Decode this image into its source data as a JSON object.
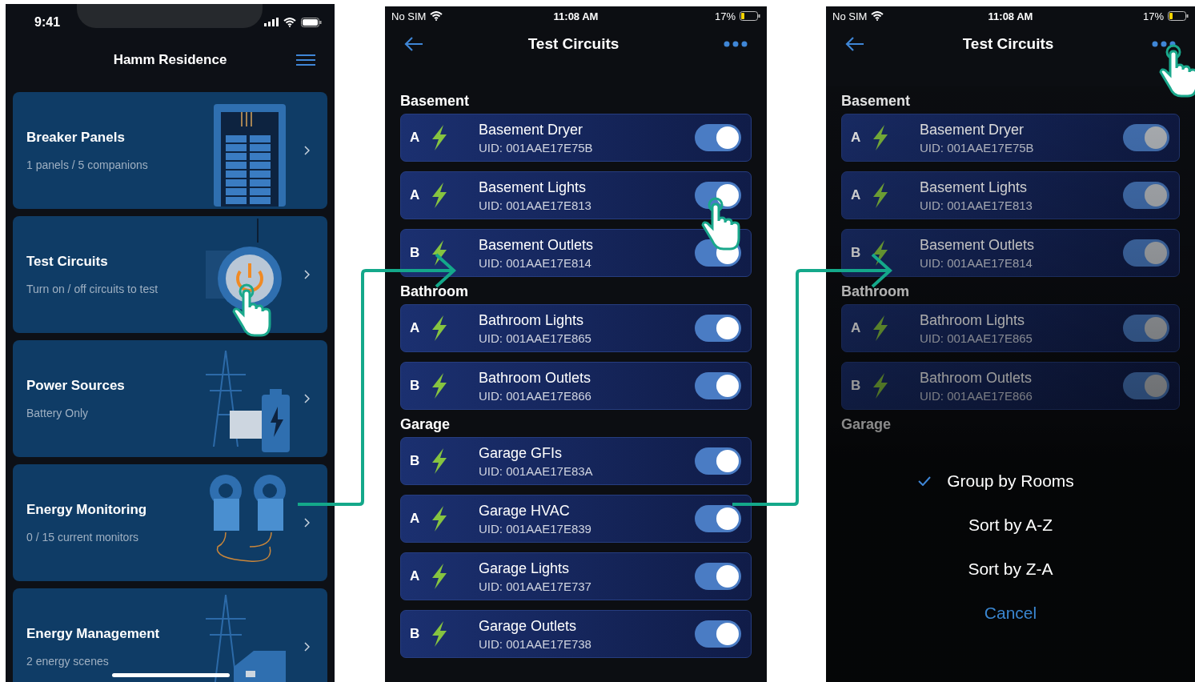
{
  "home_screen": {
    "time": "9:41",
    "title": "Hamm Residence",
    "cards": [
      {
        "kind": "panel",
        "title": "Breaker Panels",
        "subtitle": "1 panels / 5 companions"
      },
      {
        "kind": "power",
        "title": "Test Circuits",
        "subtitle": "Turn on / off circuits to test"
      },
      {
        "kind": "sources",
        "title": "Power Sources",
        "subtitle": "Battery Only"
      },
      {
        "kind": "monitor",
        "title": "Energy Monitoring",
        "subtitle": "0  / 15 current monitors"
      },
      {
        "kind": "management",
        "title": "Energy Management",
        "subtitle": "2 energy scenes"
      }
    ]
  },
  "circuits_screen": {
    "carrier": "No SIM",
    "time": "11:08 AM",
    "battery": "17%",
    "title": "Test Circuits",
    "groups": [
      {
        "name": "Basement",
        "circuits": [
          {
            "phase": "A",
            "name": "Basement Dryer",
            "uid": "UID: 001AAE17E75B",
            "on": true
          },
          {
            "phase": "A",
            "name": "Basement Lights",
            "uid": "UID: 001AAE17E813",
            "on": true
          },
          {
            "phase": "B",
            "name": "Basement Outlets",
            "uid": "UID: 001AAE17E814",
            "on": true
          }
        ]
      },
      {
        "name": "Bathroom",
        "circuits": [
          {
            "phase": "A",
            "name": "Bathroom Lights",
            "uid": "UID: 001AAE17E865",
            "on": true
          },
          {
            "phase": "B",
            "name": "Bathroom Outlets",
            "uid": "UID: 001AAE17E866",
            "on": true
          }
        ]
      },
      {
        "name": "Garage",
        "circuits": [
          {
            "phase": "B",
            "name": "Garage GFIs",
            "uid": "UID: 001AAE17E83A",
            "on": true
          },
          {
            "phase": "A",
            "name": "Garage HVAC",
            "uid": "UID: 001AAE17E839",
            "on": true
          },
          {
            "phase": "A",
            "name": "Garage Lights",
            "uid": "UID: 001AAE17E737",
            "on": true
          },
          {
            "phase": "B",
            "name": "Garage Outlets",
            "uid": "UID: 001AAE17E738",
            "on": true
          }
        ]
      }
    ]
  },
  "menu_screen": {
    "carrier": "No SIM",
    "time": "11:08 AM",
    "battery": "17%",
    "title": "Test Circuits",
    "groups": [
      {
        "name": "Basement",
        "circuits": [
          {
            "phase": "A",
            "name": "Basement Dryer",
            "uid": "UID: 001AAE17E75B",
            "on": true
          },
          {
            "phase": "A",
            "name": "Basement Lights",
            "uid": "UID: 001AAE17E813",
            "on": true
          },
          {
            "phase": "B",
            "name": "Basement Outlets",
            "uid": "UID: 001AAE17E814",
            "on": true
          }
        ]
      },
      {
        "name": "Bathroom",
        "circuits": [
          {
            "phase": "A",
            "name": "Bathroom Lights",
            "uid": "UID: 001AAE17E865",
            "on": true
          },
          {
            "phase": "B",
            "name": "Bathroom Outlets",
            "uid": "UID: 001AAE17E866",
            "on": true
          }
        ]
      },
      {
        "name": "Garage"
      }
    ],
    "options": [
      {
        "label": "Group by Rooms",
        "selected": true
      },
      {
        "label": "Sort by A-Z",
        "selected": false
      },
      {
        "label": "Sort by Z-A",
        "selected": false
      }
    ],
    "cancel": "Cancel"
  }
}
